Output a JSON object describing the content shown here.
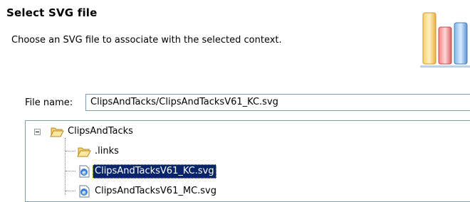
{
  "header": {
    "title": "Select SVG file",
    "description": "Choose an SVG file to associate with the selected context.",
    "graphic": "bar-chart-wizard-icon"
  },
  "filename": {
    "label": "File name:",
    "value": "ClipsAndTacks/ClipsAndTacksV61_KC.svg"
  },
  "tree": {
    "root": {
      "label": "ClipsAndTacks",
      "icon": "open-folder-icon",
      "expanded": true
    },
    "children": [
      {
        "label": ".links",
        "icon": "open-folder-icon",
        "selected": false
      },
      {
        "label": "ClipsAndTacksV61_KC.svg",
        "icon": "svg-file-icon",
        "selected": true
      },
      {
        "label": "ClipsAndTacksV61_MC.svg",
        "icon": "svg-file-icon",
        "selected": false
      }
    ]
  },
  "colors": {
    "selection": "#0a246a",
    "border": "#7f9db9"
  }
}
